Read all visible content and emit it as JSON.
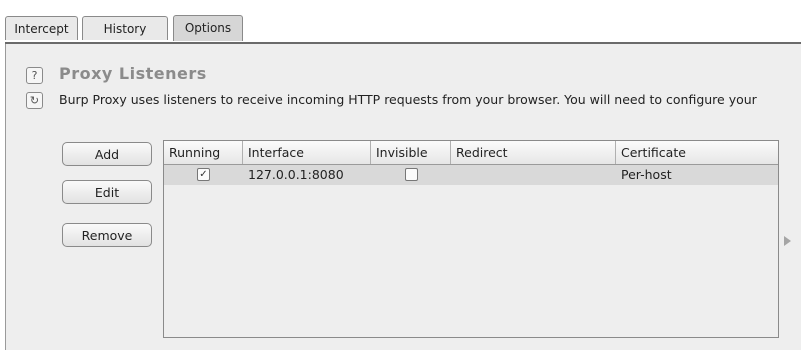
{
  "tabs": [
    {
      "label": "Intercept"
    },
    {
      "label": "History"
    },
    {
      "label": "Options"
    }
  ],
  "section": {
    "title": "Proxy Listeners",
    "description": "Burp Proxy uses listeners to receive incoming HTTP requests from your browser. You will need to configure your",
    "help_icon": "?",
    "defaults_icon": "↻"
  },
  "buttons": {
    "add": "Add",
    "edit": "Edit",
    "remove": "Remove"
  },
  "listeners_table": {
    "columns": [
      "Running",
      "Interface",
      "Invisible",
      "Redirect",
      "Certificate"
    ],
    "rows": [
      {
        "running": true,
        "running_mark": "✓",
        "interface": "127.0.0.1:8080",
        "invisible": false,
        "redirect": "",
        "certificate": "Per-host"
      }
    ]
  },
  "icons": {
    "help": "help-icon",
    "restore_defaults": "restore-defaults-icon",
    "expand_arrow": "expand-arrow-icon"
  }
}
